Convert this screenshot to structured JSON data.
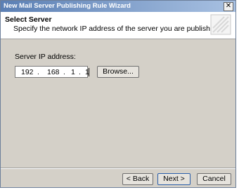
{
  "window": {
    "title": "New Mail Server Publishing Rule Wizard",
    "close_glyph": "✕"
  },
  "header": {
    "title": "Select Server",
    "subtitle": "Specify the network IP address of the server you are publishing.",
    "icon": "wizard-graphic-icon"
  },
  "form": {
    "ip_label": "Server IP address:",
    "ip_octets": [
      "192",
      "168",
      "1",
      "1"
    ],
    "dot": ".",
    "browse_label": "Browse..."
  },
  "buttons": {
    "back": "< Back",
    "next": "Next >",
    "cancel": "Cancel"
  }
}
